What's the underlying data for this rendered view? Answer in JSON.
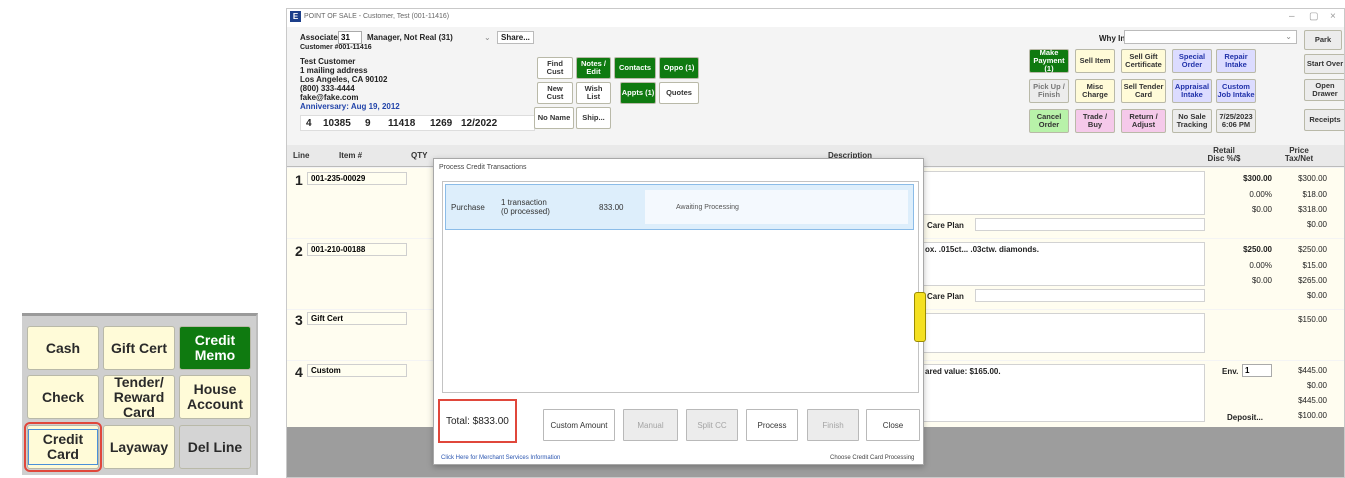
{
  "left_panel": {
    "buttons": [
      {
        "label": "Cash",
        "style": "yellow"
      },
      {
        "label": "Gift Cert",
        "style": "yellow"
      },
      {
        "label": "Credit Memo",
        "style": "green"
      },
      {
        "label": "Check",
        "style": "yellow"
      },
      {
        "label": "Tender/ Reward Card",
        "style": "yellow"
      },
      {
        "label": "House Account",
        "style": "yellow"
      },
      {
        "label": "Credit Card",
        "style": "selected"
      },
      {
        "label": "Layaway",
        "style": "yellow"
      },
      {
        "label": "Del Line",
        "style": "gray"
      }
    ]
  },
  "window": {
    "title": "POINT OF SALE - Customer, Test (001-11416)",
    "controls": [
      "–",
      "▢",
      "×"
    ]
  },
  "header": {
    "associate_label": "Associate",
    "associate_value": "31",
    "associate_name": "Manager, Not Real (31)",
    "share_label": "Share...",
    "customer_num": "Customer #001-11416",
    "customer_lines": [
      "Test Customer",
      "1 mailing address",
      "Los Angeles, CA 90102",
      "(800) 333-4444",
      "fake@fake.com"
    ],
    "anniversary": "Anniversary: Aug 19, 2012",
    "stats": [
      "4",
      "10385",
      "9",
      "11418",
      "1269",
      "12/2022"
    ],
    "why_in_label": "Why In"
  },
  "mid_buttons": [
    {
      "label": "Find Cust",
      "style": "white"
    },
    {
      "label": "Notes / Edit",
      "style": "green"
    },
    {
      "label": "Contacts",
      "style": "green"
    },
    {
      "label": "Oppo (1)",
      "style": "green"
    },
    {
      "label": "New Cust",
      "style": "white"
    },
    {
      "label": "Wish List",
      "style": "white"
    },
    {
      "label": "Appts (1)",
      "style": "green"
    },
    {
      "label": "Quotes",
      "style": "white"
    },
    {
      "label": "No Name",
      "style": "white"
    },
    {
      "label": "Ship...",
      "style": "white"
    }
  ],
  "right_buttons": [
    {
      "label": "Make Payment (1)",
      "style": "green"
    },
    {
      "label": "Sell Item",
      "style": "yellow"
    },
    {
      "label": "Sell Gift Certificate",
      "style": "yellow"
    },
    {
      "label": "Special Order",
      "style": "lav"
    },
    {
      "label": "Repair Intake",
      "style": "lav"
    },
    {
      "label": "Park",
      "style": "gray"
    },
    {
      "label": "Pick Up / Finish",
      "style": "gray"
    },
    {
      "label": "Misc Charge",
      "style": "yellow"
    },
    {
      "label": "Sell Tender Card",
      "style": "yellow"
    },
    {
      "label": "Appraisal Intake",
      "style": "lav"
    },
    {
      "label": "Custom Job Intake",
      "style": "lav"
    },
    {
      "label": "Start Over",
      "style": "gray"
    },
    {
      "label": "Cancel Order",
      "style": "lgreen"
    },
    {
      "label": "Trade / Buy",
      "style": "pink"
    },
    {
      "label": "Return / Adjust",
      "style": "pink"
    },
    {
      "label": "No Sale Tracking",
      "style": "gray"
    },
    {
      "label": "7/25/2023 6:06 PM",
      "style": "gray"
    },
    {
      "label": "Open Drawer",
      "style": "gray"
    },
    {
      "label": "Receipts",
      "style": "gray"
    }
  ],
  "grid": {
    "columns": [
      "Line",
      "Item #",
      "QTY",
      "Description",
      "Retail Disc %/$",
      "Price Tax/Net"
    ],
    "lines": [
      {
        "num": "1",
        "item": "001-235-00029",
        "desc": "",
        "care_plan": "Care Plan",
        "retail": [
          "$300.00",
          "0.00%",
          "$0.00"
        ],
        "price": [
          "$300.00",
          "$18.00",
          "$318.00",
          "$0.00"
        ]
      },
      {
        "num": "2",
        "item": "001-210-00188",
        "desc": "ox. .015ct... .03ctw. diamonds.",
        "care_plan": "Care Plan",
        "retail": [
          "$250.00",
          "0.00%",
          "$0.00"
        ],
        "price": [
          "$250.00",
          "$15.00",
          "$265.00",
          "$0.00"
        ]
      },
      {
        "num": "3",
        "item": "Gift Cert",
        "desc": "",
        "care_plan": "",
        "retail": [],
        "price": [
          "$150.00"
        ]
      },
      {
        "num": "4",
        "item": "Custom",
        "desc": "ared value: $165.00.",
        "env_label": "Env.",
        "env_value": "1",
        "deposit_label": "Deposit...",
        "price": [
          "$445.00",
          "$0.00",
          "$445.00",
          "$100.00"
        ]
      }
    ]
  },
  "dialog": {
    "title": "Process Credit Transactions",
    "row": {
      "type": "Purchase",
      "count": "1 transaction",
      "processed": "(0 processed)",
      "amount": "833.00",
      "status": "Awaiting Processing"
    },
    "total": "Total: $833.00",
    "buttons": [
      {
        "label": "Custom Amount",
        "enabled": true
      },
      {
        "label": "Manual",
        "enabled": false
      },
      {
        "label": "Split CC",
        "enabled": false
      },
      {
        "label": "Process",
        "enabled": true
      },
      {
        "label": "Finish",
        "enabled": false
      },
      {
        "label": "Close",
        "enabled": true
      }
    ],
    "merchant_link": "Click Here for Merchant Services Information",
    "choose_link": "Choose Credit Card Processing"
  }
}
